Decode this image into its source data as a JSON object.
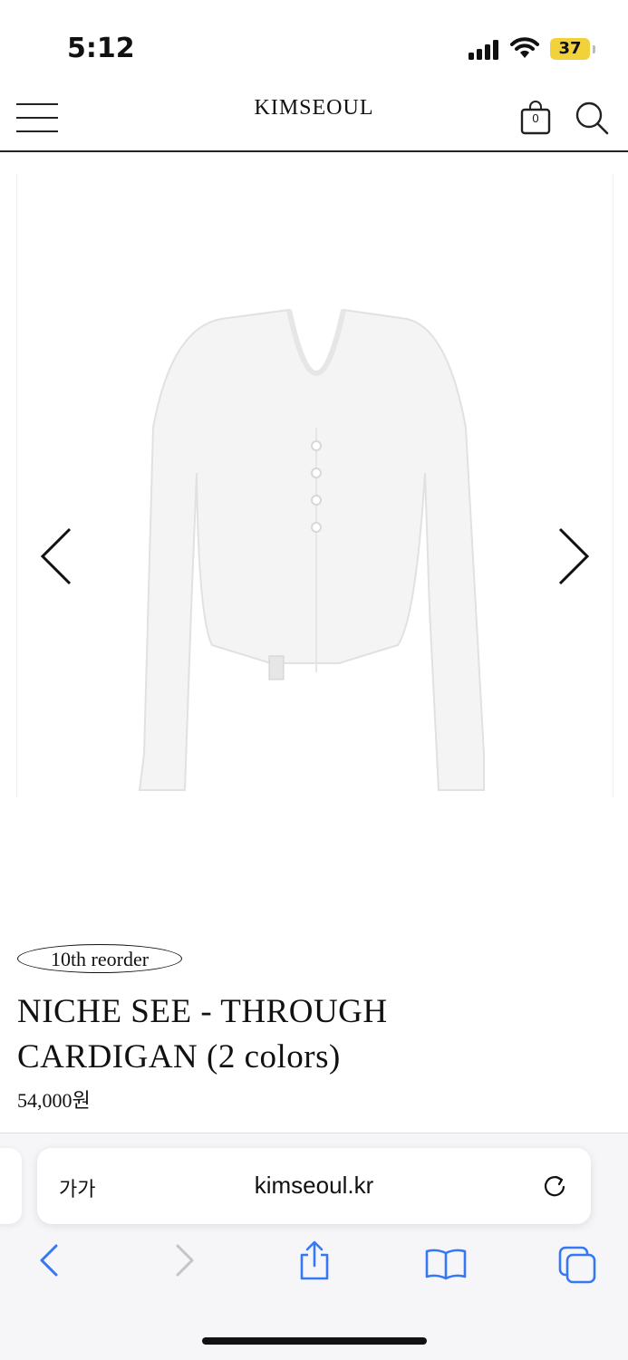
{
  "status": {
    "time": "5:12",
    "battery": "37"
  },
  "header": {
    "brand": "KIMSEOUL",
    "cart_count": "0"
  },
  "product": {
    "badge": "10th reorder",
    "title": "NICHE SEE - THROUGH CARDIGAN (2 colors)",
    "price": "54,000원"
  },
  "browser": {
    "text_size_label": "가가",
    "url": "kimseoul.kr"
  },
  "colors": {
    "accent": "#3478f6",
    "battery": "#f2d23b",
    "text": "#111111"
  }
}
